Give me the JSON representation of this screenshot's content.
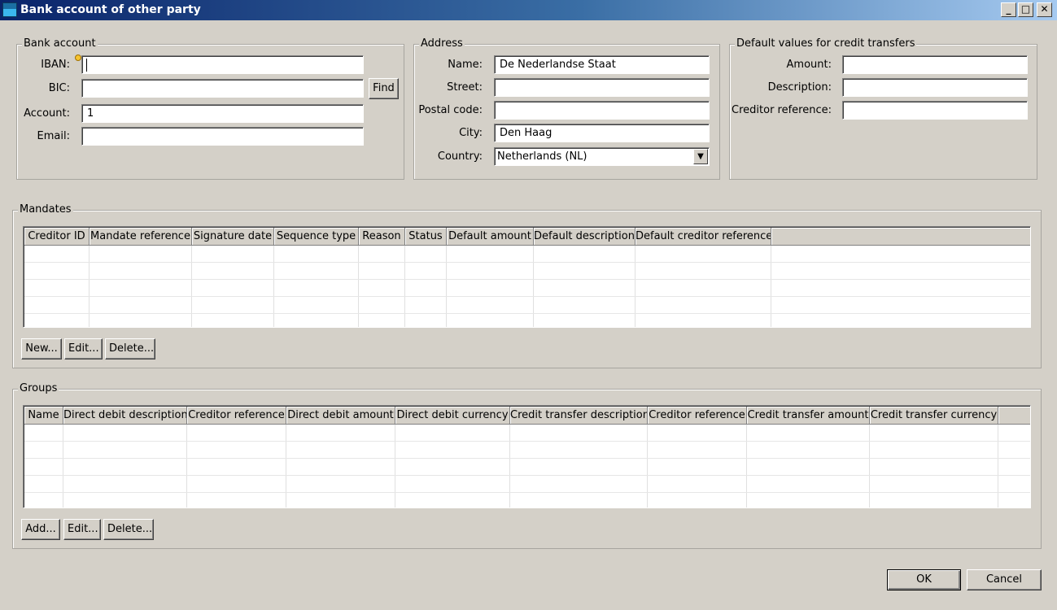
{
  "window": {
    "title": "Bank account of other party",
    "minimize": "_",
    "maximize": "□",
    "close": "✕"
  },
  "bank_account": {
    "legend": "Bank account",
    "iban_label": "IBAN:",
    "iban_value": "",
    "bic_label": "BIC:",
    "bic_value": "",
    "find_button": "Find",
    "account_label": "Account:",
    "account_value": "1",
    "email_label": "Email:",
    "email_value": ""
  },
  "address": {
    "legend": "Address",
    "name_label": "Name:",
    "name_value": "De Nederlandse Staat",
    "street_label": "Street:",
    "street_value": "",
    "postal_label": "Postal code:",
    "postal_value": "",
    "city_label": "City:",
    "city_value": "Den Haag",
    "country_label": "Country:",
    "country_value": "Netherlands (NL)"
  },
  "defaults": {
    "legend": "Default values for credit transfers",
    "amount_label": "Amount:",
    "amount_value": "",
    "description_label": "Description:",
    "description_value": "",
    "creditor_label": "Creditor reference:",
    "creditor_value": ""
  },
  "mandates": {
    "legend": "Mandates",
    "columns": [
      "Creditor ID",
      "Mandate reference",
      "Signature date",
      "Sequence type",
      "Reason",
      "Status",
      "Default amount",
      "Default description",
      "Default creditor reference"
    ],
    "new_button": "New...",
    "edit_button": "Edit...",
    "delete_button": "Delete..."
  },
  "groups": {
    "legend": "Groups",
    "columns": [
      "Name",
      "Direct debit description",
      "Creditor reference",
      "Direct debit amount",
      "Direct debit currency",
      "Credit transfer description",
      "Creditor reference",
      "Credit transfer amount",
      "Credit transfer currency"
    ],
    "add_button": "Add...",
    "edit_button": "Edit...",
    "delete_button": "Delete..."
  },
  "footer": {
    "ok_button": "OK",
    "cancel_button": "Cancel"
  }
}
